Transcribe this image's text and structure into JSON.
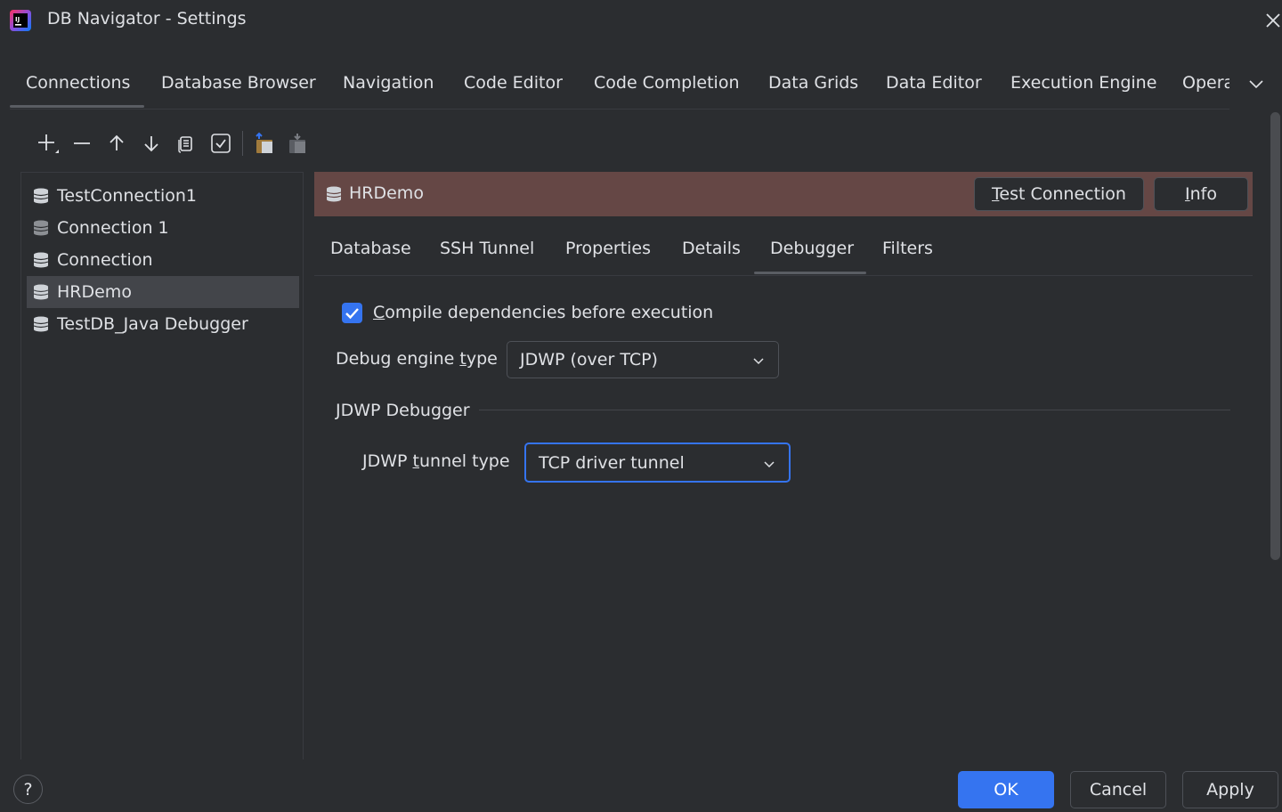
{
  "window": {
    "title": "DB Navigator - Settings",
    "logo_icon": "intellij-logo-icon",
    "close_icon": "close-icon"
  },
  "top_tabs": [
    {
      "label": "Connections",
      "selected": true
    },
    {
      "label": "Database Browser"
    },
    {
      "label": "Navigation"
    },
    {
      "label": "Code Editor"
    },
    {
      "label": "Code Completion"
    },
    {
      "label": "Data Grids"
    },
    {
      "label": "Data Editor"
    },
    {
      "label": "Execution Engine"
    },
    {
      "label": "Opera"
    }
  ],
  "toolbar": {
    "icons": [
      "add-icon",
      "remove-icon",
      "move-up-icon",
      "move-down-icon",
      "copy-icon",
      "check-icon",
      "export-icon",
      "import-icon"
    ]
  },
  "connections": [
    {
      "label": "TestConnection1"
    },
    {
      "label": "Connection 1"
    },
    {
      "label": "Connection"
    },
    {
      "label": "HRDemo",
      "selected": true
    },
    {
      "label": "TestDB_Java Debugger"
    }
  ],
  "connection_header": {
    "name": "HRDemo",
    "test_button": {
      "mnemonic": "T",
      "rest": "est Connection"
    },
    "info_button": {
      "mnemonic": "I",
      "rest": "nfo"
    },
    "bg_color": "#654745"
  },
  "sub_tabs": [
    {
      "label": "Database"
    },
    {
      "label": "SSH Tunnel"
    },
    {
      "label": "Properties"
    },
    {
      "label": "Details"
    },
    {
      "label": "Debugger",
      "selected": true
    },
    {
      "label": "Filters"
    }
  ],
  "debugger": {
    "compile_checkbox": {
      "mnemonic": "C",
      "rest": "ompile dependencies before execution",
      "checked": true
    },
    "engine_label": {
      "pre": "Debug engine ",
      "mnemonic": "t",
      "rest": "ype"
    },
    "engine_value": "JDWP (over TCP)",
    "group_title": "JDWP Debugger",
    "tunnel_label": {
      "pre": "JDWP ",
      "mnemonic": "t",
      "rest": "unnel type"
    },
    "tunnel_value": "TCP driver tunnel"
  },
  "footer": {
    "help": "?",
    "ok": "OK",
    "cancel": "Cancel",
    "apply": "Apply"
  },
  "colors": {
    "accent": "#3574f0",
    "background": "#2b2d30",
    "selection": "#43454a"
  }
}
